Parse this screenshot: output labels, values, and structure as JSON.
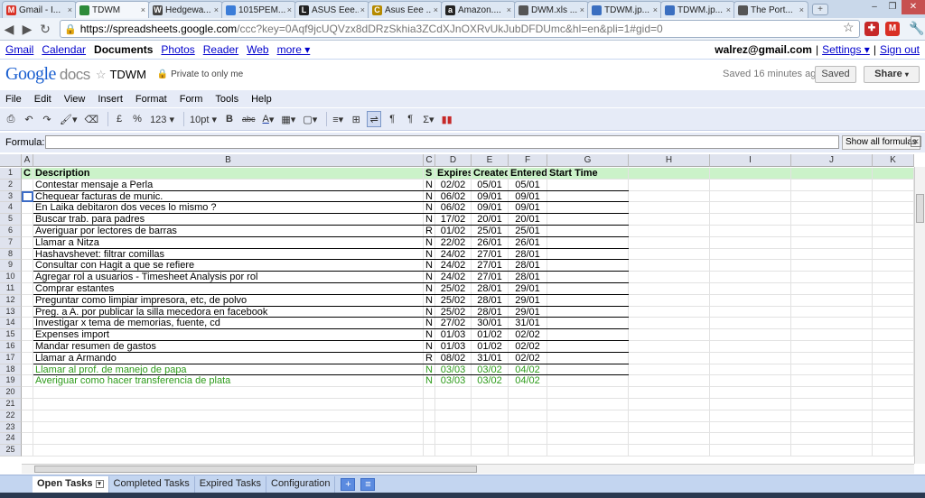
{
  "browser": {
    "tabs": [
      {
        "label": "Gmail - I...",
        "icon": "gmail-icon",
        "color": "#d93025",
        "glyph": "M"
      },
      {
        "label": "TDWM",
        "icon": "spreadsheet-icon",
        "color": "#2e8b3a",
        "glyph": ""
      },
      {
        "label": "Hedgewa...",
        "icon": "wikipedia-icon",
        "color": "#444444",
        "glyph": "W"
      },
      {
        "label": "1015PEM...",
        "icon": "page-icon",
        "color": "#3b7dd8",
        "glyph": ""
      },
      {
        "label": "ASUS Eee...",
        "icon": "page-icon",
        "color": "#222222",
        "glyph": "L"
      },
      {
        "label": "Asus Eee ...",
        "icon": "page-icon",
        "color": "#b58a00",
        "glyph": "C"
      },
      {
        "label": "Amazon....",
        "icon": "amazon-icon",
        "color": "#222222",
        "glyph": "a"
      },
      {
        "label": "DWM.xls ...",
        "icon": "file-icon",
        "color": "#555555",
        "glyph": ""
      },
      {
        "label": "TDWM.jp...",
        "icon": "image-icon",
        "color": "#3b6fc0",
        "glyph": ""
      },
      {
        "label": "TDWM.jp...",
        "icon": "image-icon",
        "color": "#3b6fc0",
        "glyph": ""
      },
      {
        "label": "The Port...",
        "icon": "page-icon",
        "color": "#555555",
        "glyph": ""
      }
    ],
    "url_host": "https://spreadsheets.google.com",
    "url_rest": "/ccc?key=0Aqf9jcUQVzx8dDRzSkhia3ZCdXJnOXRvUkJubDFDUmc&hl=en&pli=1#gid=0"
  },
  "gbar": {
    "links": [
      "Gmail",
      "Calendar",
      "Documents",
      "Photos",
      "Reader",
      "Web",
      "more ▾"
    ],
    "email": "walrez@gmail.com",
    "settings": "Settings ▾",
    "sep": "|",
    "signout": "Sign out"
  },
  "doc": {
    "logo_google": "Google",
    "logo_docs": "docs",
    "title": "TDWM",
    "privacy": "Private to only me",
    "saved_msg": "Saved 16 minutes ago",
    "saved_btn": "Saved",
    "share_btn": "Share"
  },
  "menu": [
    "File",
    "Edit",
    "View",
    "Insert",
    "Format",
    "Form",
    "Tools",
    "Help"
  ],
  "toolbar": {
    "currency": "£",
    "percent": "%",
    "numfmt": "123 ▾",
    "fontsize": "10pt ▾",
    "bold": "B",
    "strike": "abc"
  },
  "formula": {
    "label": "Formula:",
    "value": "",
    "show_all": "Show all formulas"
  },
  "columns": [
    "A",
    "B",
    "C",
    "D",
    "E",
    "F",
    "G",
    "H",
    "I",
    "J",
    "K"
  ],
  "header_row": [
    "C",
    "Description",
    "S",
    "Expires",
    "Created",
    "Entered",
    "Start Time"
  ],
  "rows": [
    {
      "desc": "Contestar mensaje a Perla",
      "s": "N",
      "exp": "02/02",
      "cre": "05/01",
      "ent": "05/01"
    },
    {
      "desc": "Chequear facturas de munic.",
      "s": "N",
      "exp": "06/02",
      "cre": "09/01",
      "ent": "09/01"
    },
    {
      "desc": "En Laika debitaron dos veces lo mismo ?",
      "s": "N",
      "exp": "06/02",
      "cre": "09/01",
      "ent": "09/01"
    },
    {
      "desc": "Buscar trab. para padres",
      "s": "N",
      "exp": "17/02",
      "cre": "20/01",
      "ent": "20/01"
    },
    {
      "desc": "Averiguar por lectores de barras",
      "s": "R",
      "exp": "01/02",
      "cre": "25/01",
      "ent": "25/01"
    },
    {
      "desc": "Llamar a Nitza",
      "s": "N",
      "exp": "22/02",
      "cre": "26/01",
      "ent": "26/01"
    },
    {
      "desc": "Hashavshevet: filtrar comillas",
      "s": "N",
      "exp": "24/02",
      "cre": "27/01",
      "ent": "28/01"
    },
    {
      "desc": "Consultar con Hagit a que se refiere",
      "s": "N",
      "exp": "24/02",
      "cre": "27/01",
      "ent": "28/01"
    },
    {
      "desc": "Agregar rol a usuarios - Timesheet Analysis por rol",
      "s": "N",
      "exp": "24/02",
      "cre": "27/01",
      "ent": "28/01"
    },
    {
      "desc": "Comprar estantes",
      "s": "N",
      "exp": "25/02",
      "cre": "28/01",
      "ent": "29/01"
    },
    {
      "desc": "Preguntar como limpiar impresora, etc, de polvo",
      "s": "N",
      "exp": "25/02",
      "cre": "28/01",
      "ent": "29/01"
    },
    {
      "desc": "Preg. a A. por publicar la silla mecedora en facebook",
      "s": "N",
      "exp": "25/02",
      "cre": "28/01",
      "ent": "29/01"
    },
    {
      "desc": "Investigar x tema de memorias, fuente, cd",
      "s": "N",
      "exp": "27/02",
      "cre": "30/01",
      "ent": "31/01"
    },
    {
      "desc": "Expenses import",
      "s": "N",
      "exp": "01/03",
      "cre": "01/02",
      "ent": "02/02"
    },
    {
      "desc": "Mandar resumen de gastos",
      "s": "N",
      "exp": "01/03",
      "cre": "01/02",
      "ent": "02/02"
    },
    {
      "desc": "Llamar a Armando",
      "s": "R",
      "exp": "08/02",
      "cre": "31/01",
      "ent": "02/02"
    },
    {
      "desc": "Llamar al prof. de manejo de papa",
      "s": "N",
      "exp": "03/03",
      "cre": "03/02",
      "ent": "04/02",
      "green": true
    },
    {
      "desc": "Averiguar como hacer transferencia de plata",
      "s": "N",
      "exp": "03/03",
      "cre": "03/02",
      "ent": "04/02",
      "green": true
    }
  ],
  "row_numbers": [
    "1",
    "2",
    "3",
    "4",
    "5",
    "6",
    "7",
    "8",
    "9",
    "10",
    "11",
    "12",
    "13",
    "14",
    "15",
    "16",
    "17",
    "18",
    "19",
    "20",
    "21",
    "22",
    "23",
    "24",
    "25"
  ],
  "sheets": [
    "Open Tasks",
    "Completed Tasks",
    "Expired Tasks",
    "Configuration"
  ],
  "colors": {
    "header_green": "#cbf2c9",
    "green_text": "#2d9b1a",
    "toolbar_bg": "#e6ebf7"
  }
}
